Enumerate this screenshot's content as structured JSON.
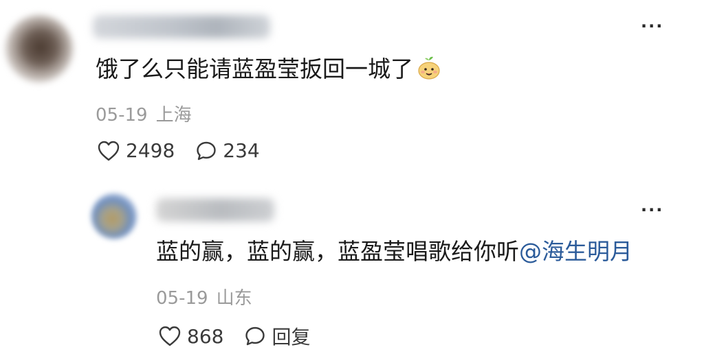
{
  "comment": {
    "username": "",
    "text": "饿了么只能请蓝盈莹扳回一城了",
    "emoji": "sprout-bun-emoji",
    "date": "05-19",
    "location": "上海",
    "likes": "2498",
    "replies": "234",
    "more_label": "···"
  },
  "reply": {
    "username": "",
    "text": "蓝的赢，蓝的赢，蓝盈莹唱歌给你听",
    "mention": "@海生明月",
    "date": "05-19",
    "location": "山东",
    "likes": "868",
    "reply_label": "回复",
    "more_label": "···"
  },
  "colors": {
    "text": "#1a1a1a",
    "meta": "#9a9a9a",
    "mention": "#2b5b9a",
    "icon": "#3a3a3a"
  }
}
